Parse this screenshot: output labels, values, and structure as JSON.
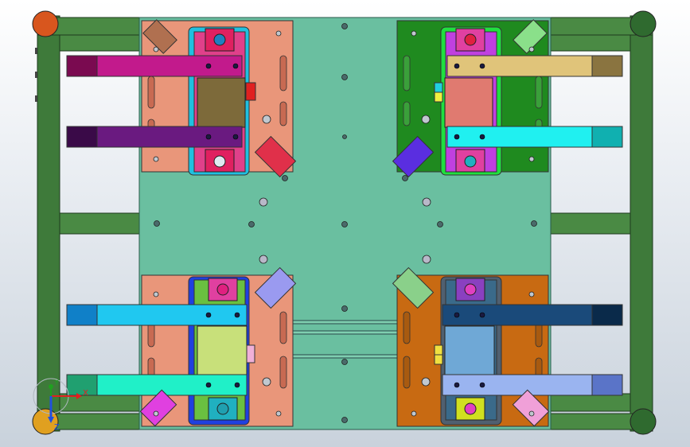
{
  "view": {
    "type": "cad-viewport",
    "projection": "top"
  },
  "colors": {
    "background_top": "#ffffff",
    "background_bottom": "#c9d2dc",
    "frame": "#3e7a3a",
    "base_plate": "#6abfa0",
    "station_top_left_plate": "#e9967a",
    "station_top_right_plate": "#1f8a1f",
    "station_bottom_left_plate": "#e9967a",
    "station_bottom_right_plate": "#c86a12",
    "station_top_left_block": "#7d6a3a",
    "station_top_right_block": "#e07a70",
    "station_bottom_left_block": "#c8e07a",
    "station_bottom_right_block": "#6fa8d6"
  },
  "axis_triad": {
    "labels": [
      "X",
      "Y",
      "Z"
    ],
    "colors": [
      "#e02020",
      "#20a020",
      "#2050e0"
    ]
  },
  "stations": [
    {
      "id": "top-left",
      "pusher_upper": "#c21a8c",
      "pusher_lower": "#6a1a80",
      "cylinder": "#e0304a"
    },
    {
      "id": "top-right",
      "pusher_upper": "#e0c47a",
      "pusher_lower": "#20f0f0",
      "cylinder": "#5a2ee0"
    },
    {
      "id": "bottom-left",
      "pusher_upper": "#20c8f0",
      "pusher_lower": "#20f0c8",
      "cylinder": "#9a9af0"
    },
    {
      "id": "bottom-right",
      "pusher_upper": "#1a4a7a",
      "pusher_lower": "#9ab4f0",
      "cylinder": "#8ad08a"
    }
  ]
}
